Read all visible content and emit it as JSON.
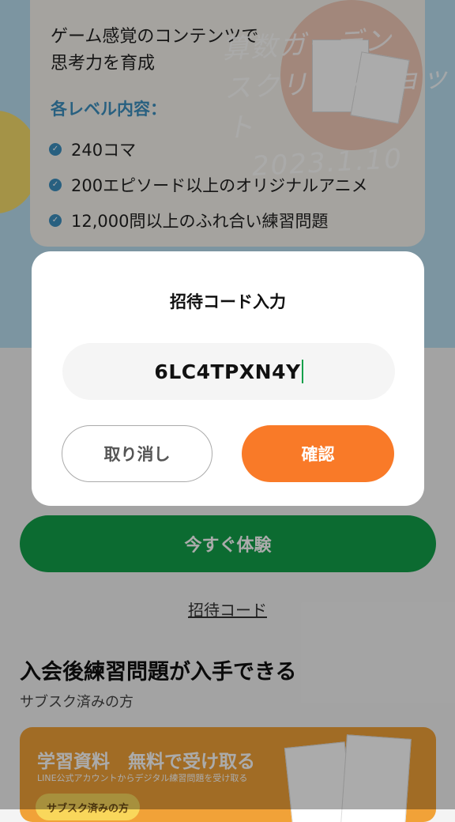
{
  "promo": {
    "headline_line1": "ゲーム感覚のコンテンツで",
    "headline_line2": "思考力を育成",
    "level_title": "各レベル内容：",
    "bullets": [
      "240コマ",
      "200エピソード以上のオリジナルアニメ",
      "12,000問以上のふれ合い練習問題"
    ],
    "watermark_line1": "算数ガーデン",
    "watermark_line2": "スクリーンショット",
    "watermark_line3": "2023.1.10"
  },
  "dialog": {
    "title": "招待コード入力",
    "code_value": "6LC4TPXN4Y",
    "cancel_label": "取り消し",
    "confirm_label": "確認"
  },
  "main": {
    "trial_button_label": "今すぐ体験",
    "invite_link_label": "招待コード",
    "section_title": "入会後練習問題が入手できる",
    "section_subtitle": "サブスク済みの方",
    "banner_title": "学習資料　無料で受け取る",
    "banner_subtitle": "LINE公式アカウントからデジタル練習問題を受け取る",
    "banner_chip_label": "サブスク済みの方"
  },
  "colors": {
    "accent_green": "#12a04a",
    "accent_orange": "#f97a28",
    "level_blue": "#3d8fbf",
    "banner_orange": "#f1a238"
  }
}
